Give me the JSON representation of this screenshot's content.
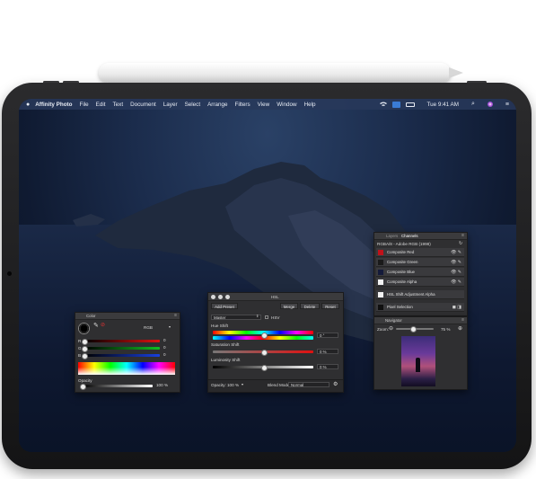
{
  "menubar": {
    "apple": "",
    "app_name": "Affinity Photo",
    "menus": [
      "File",
      "Edit",
      "Text",
      "Document",
      "Layer",
      "Select",
      "Arrange",
      "Filters",
      "View",
      "Window",
      "Help"
    ],
    "time": "Tue 9:41 AM"
  },
  "color_panel": {
    "title": "Color",
    "mode": "RGB",
    "r_value": "0",
    "g_value": "0",
    "b_value": "0",
    "opacity_label": "Opacity",
    "opacity_value": "100 %"
  },
  "hsl_panel": {
    "title": "HSL",
    "add_preset": "Add Preset",
    "merge": "Merge",
    "delete": "Delete",
    "reset": "Reset",
    "channel": "Master",
    "model": "HSV",
    "hue_label": "Hue Shift",
    "hue_value": "0 °",
    "saturation_label": "Saturation Shift",
    "saturation_value": "0 %",
    "luminosity_label": "Luminosity Shift",
    "luminosity_value": "0 %",
    "opacity_label": "Opacity:",
    "opacity_value": "100 %",
    "blend_label": "Blend Mode:",
    "blend_value": "Normal"
  },
  "channels_panel": {
    "tab_layers": "Layers",
    "tab_channels": "Channels",
    "header": "RGBA/8 - Adobe RGB (1998)",
    "rows": [
      {
        "label": "Composite Red",
        "color": "#c0121a"
      },
      {
        "label": "Composite Green",
        "color": "#1a1a1a"
      },
      {
        "label": "Composite Blue",
        "color": "#141a3a"
      },
      {
        "label": "Composite Alpha",
        "color": "#f2f2f2"
      },
      {
        "label": "HSL Shift Adjustment Alpha",
        "color": "#f2f2f2"
      },
      {
        "label": "Pixel Selection",
        "color": "#101010"
      }
    ]
  },
  "navigator_panel": {
    "title": "Navigator",
    "zoom_label": "Zoom:",
    "zoom_value": "75 %"
  },
  "colors": {
    "accent": "#3a7bd5"
  }
}
